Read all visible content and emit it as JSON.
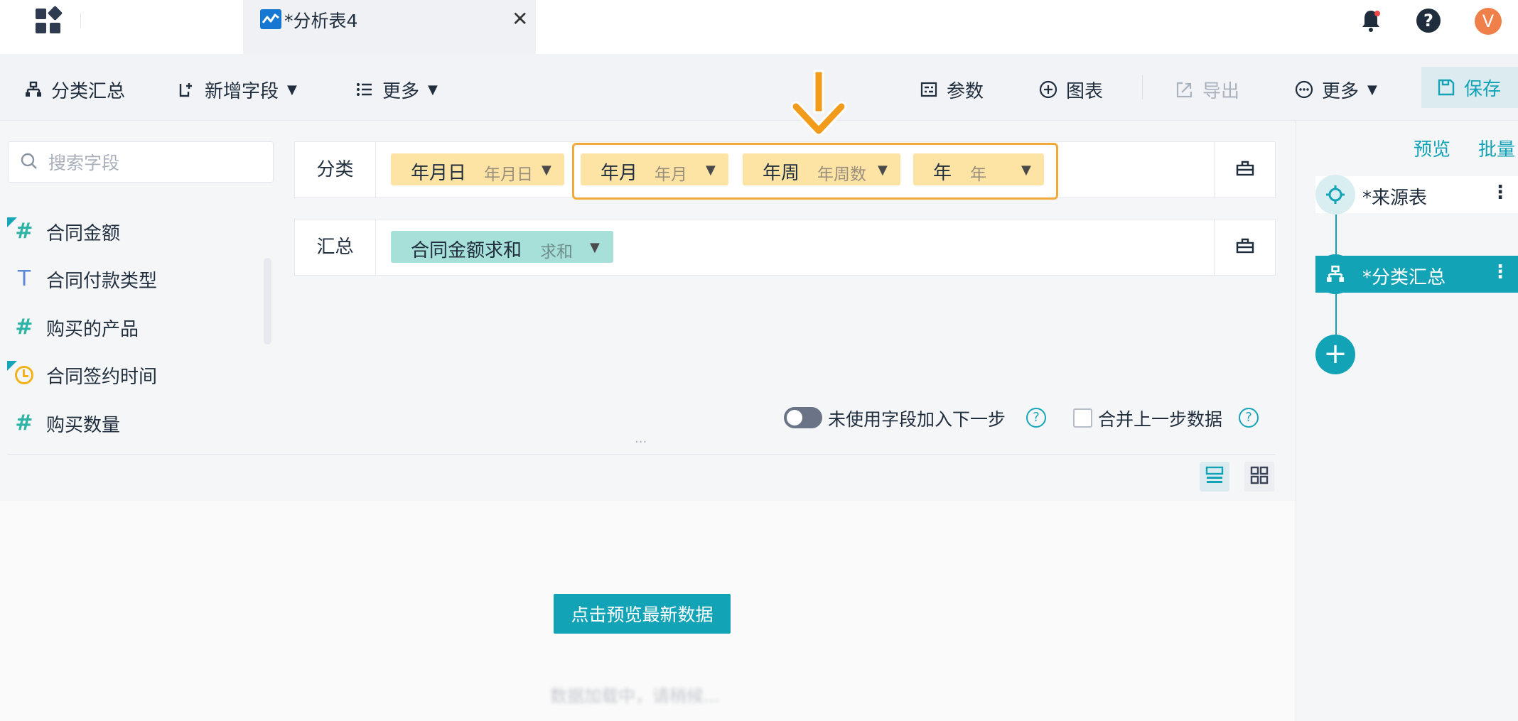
{
  "topbar": {
    "tab_title": "*分析表4",
    "close_glyph": "✕",
    "help_glyph": "?",
    "avatar_initial": "V"
  },
  "toolbar": {
    "group_summary": "分类汇总",
    "add_field": "新增字段",
    "more_left": "更多",
    "params": "参数",
    "chart": "图表",
    "export": "导出",
    "more_right": "更多",
    "save": "保存",
    "caret": "▼"
  },
  "search": {
    "placeholder": "搜索字段"
  },
  "fields": [
    {
      "label": "合同金额",
      "icon": "number-icon",
      "glyph": "#"
    },
    {
      "label": "合同付款类型",
      "icon": "text-icon",
      "glyph": "T"
    },
    {
      "label": "购买的产品",
      "icon": "number-icon",
      "glyph": "#"
    },
    {
      "label": "合同签约时间",
      "icon": "clock-icon",
      "glyph": ""
    },
    {
      "label": "购买数量",
      "icon": "number-icon",
      "glyph": "#"
    }
  ],
  "classify": {
    "label": "分类",
    "chips": [
      {
        "name": "年月日",
        "type": "年月日"
      },
      {
        "name": "年月",
        "type": "年月"
      },
      {
        "name": "年周",
        "type": "年周数"
      },
      {
        "name": "年",
        "type": "年"
      }
    ]
  },
  "summary": {
    "label": "汇总",
    "chips": [
      {
        "name": "合同金额求和",
        "type": "求和"
      }
    ]
  },
  "options": {
    "unused_fields": "未使用字段加入下一步",
    "merge_prev": "合并上一步数据",
    "help_glyph": "?"
  },
  "resize_handle": "···",
  "preview": {
    "button": "点击预览最新数据",
    "loading": "数据加载中，请稍候..."
  },
  "right_panel": {
    "preview_link": "预览",
    "batch_link": "批量",
    "nodes": [
      {
        "label": "*来源表"
      },
      {
        "label": "*分类汇总"
      }
    ],
    "node_menu": "⋮",
    "add_glyph": "+"
  },
  "colors": {
    "accent": "#13a3b7",
    "chip_yellow": "#fde3a4",
    "chip_teal": "#a7dfd9",
    "highlight": "#f2a93b",
    "avatar": "#f0804a"
  }
}
